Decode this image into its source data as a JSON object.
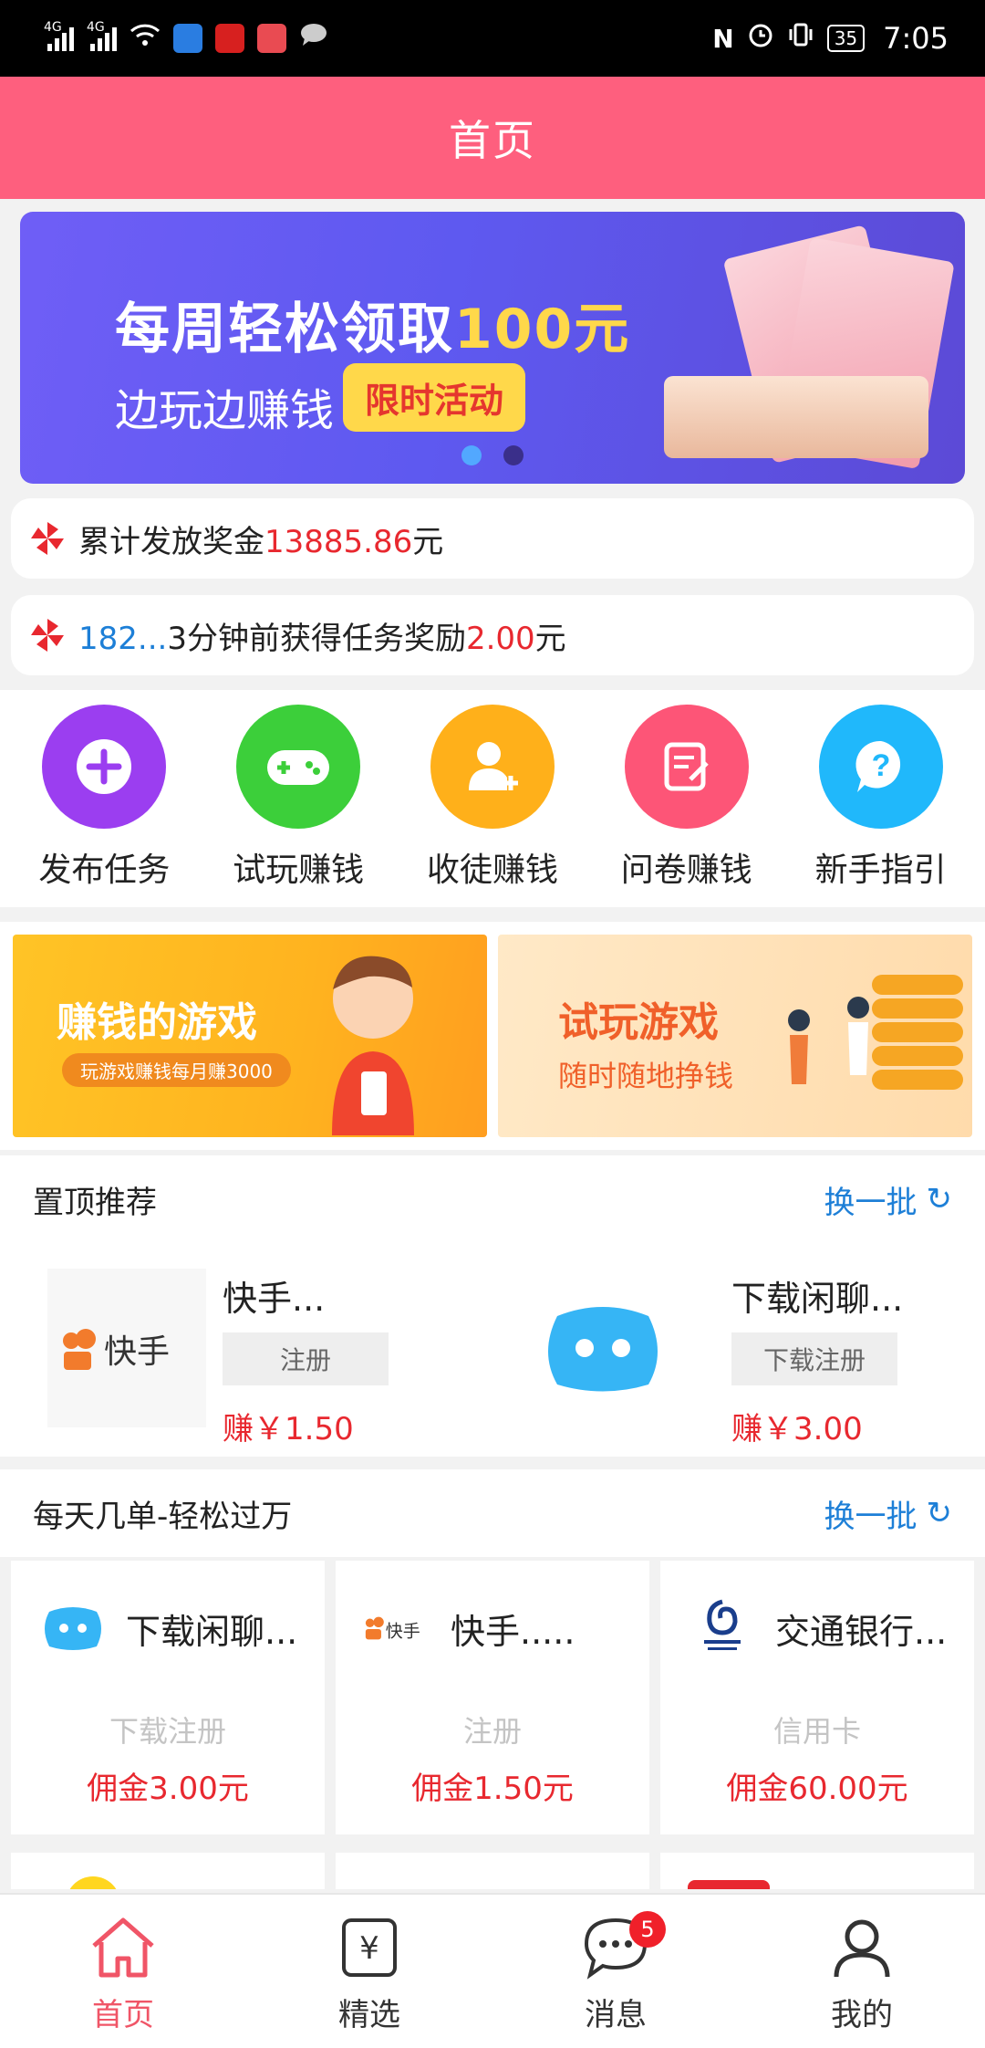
{
  "status_bar": {
    "net1": "4G",
    "net2": "4G",
    "battery": "35",
    "time": "7:05"
  },
  "header": {
    "title": "首页"
  },
  "banner": {
    "main_prefix": "每周轻松领取",
    "main_amount": "100元",
    "sub": "边玩边赚钱",
    "tag": "限时活动"
  },
  "ticker1": {
    "prefix": "累计发放奖金",
    "amount": "13885.86",
    "suffix": "元"
  },
  "ticker2": {
    "user": "182...",
    "text": "3分钟前获得任务奖励",
    "amount": "2.00",
    "suffix": "元"
  },
  "quick_actions": [
    {
      "label": "发布任务",
      "color": "#9b3ef0"
    },
    {
      "label": "试玩赚钱",
      "color": "#3ccf3a"
    },
    {
      "label": "收徒赚钱",
      "color": "#ffb01a"
    },
    {
      "label": "问卷赚钱",
      "color": "#fd5577"
    },
    {
      "label": "新手指引",
      "color": "#20b8fb"
    }
  ],
  "promos": [
    {
      "title": "赚钱的游戏",
      "sub": "玩游戏赚钱每月赚3000"
    },
    {
      "title": "试玩游戏",
      "sub": "随时随地挣钱"
    }
  ],
  "top_section": {
    "title": "置顶推荐",
    "refresh": "换一批",
    "cards": [
      {
        "logo_text": "快手",
        "title": "快手...",
        "button": "注册",
        "earn": "赚￥1.50"
      },
      {
        "logo_text": "",
        "title": "下载闲聊...",
        "button": "下载注册",
        "earn": "赚￥3.00"
      }
    ]
  },
  "daily_section": {
    "title": "每天几单-轻松过万",
    "refresh": "换一批",
    "cards": [
      {
        "title": "下载闲聊...",
        "type": "下载注册",
        "commission": "佣金3.00元"
      },
      {
        "logo_text": "快手",
        "title": "快手.....",
        "type": "注册",
        "commission": "佣金1.50元"
      },
      {
        "title": "交通银行...",
        "type": "信用卡",
        "commission": "佣金60.00元"
      }
    ]
  },
  "tabbar": {
    "tabs": [
      {
        "label": "首页"
      },
      {
        "label": "精选",
        "icon_glyph": "¥"
      },
      {
        "label": "消息",
        "badge": "5"
      },
      {
        "label": "我的"
      }
    ]
  }
}
